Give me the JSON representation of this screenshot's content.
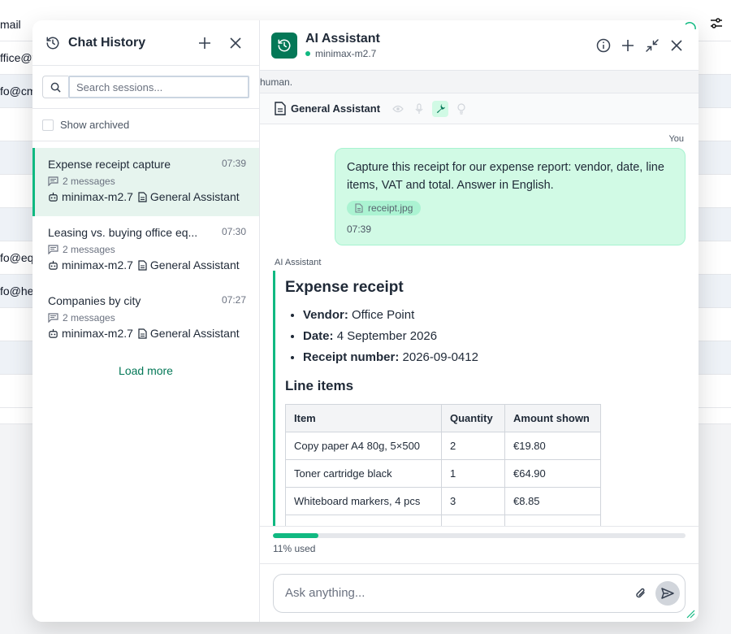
{
  "background": {
    "header_col": "mail",
    "cells": [
      "ffice@y",
      "fo@cm",
      "",
      "",
      "",
      "",
      "fo@eq",
      "fo@he",
      "",
      "",
      ""
    ]
  },
  "history": {
    "title": "Chat History",
    "search_placeholder": "Search sessions...",
    "show_archived_label": "Show archived",
    "sessions": [
      {
        "title": "Expense receipt capture",
        "time": "07:39",
        "messages": "2 messages",
        "model": "minimax-m2.7",
        "assistant": "General Assistant"
      },
      {
        "title": "Leasing vs. buying office eq...",
        "time": "07:30",
        "messages": "2 messages",
        "model": "minimax-m2.7",
        "assistant": "General Assistant"
      },
      {
        "title": "Companies by city",
        "time": "07:27",
        "messages": "2 messages",
        "model": "minimax-m2.7",
        "assistant": "General Assistant"
      }
    ],
    "load_more": "Load more"
  },
  "chat": {
    "title": "AI Assistant",
    "model": "minimax-m2.7",
    "notice": "human.",
    "assistant_name": "General Assistant",
    "you_label": "You",
    "user_message": "Capture this receipt for our expense report: vendor, date, line items, VAT and total. Answer in English.",
    "attachment": "receipt.jpg",
    "user_time": "07:39",
    "ai_label": "AI Assistant",
    "response": {
      "heading": "Expense receipt",
      "facts": [
        {
          "key": "Vendor:",
          "value": "Office Point"
        },
        {
          "key": "Date:",
          "value": "4 September 2026"
        },
        {
          "key": "Receipt number:",
          "value": "2026-09-0412"
        }
      ],
      "subheading": "Line items",
      "table_headers": [
        "Item",
        "Quantity",
        "Amount shown"
      ],
      "table_rows": [
        [
          "Copy paper A4 80g, 5×500",
          "2",
          "€19.80"
        ],
        [
          "Toner cartridge black",
          "1",
          "€64.90"
        ],
        [
          "Whiteboard markers, 4 pcs",
          "3",
          "€8.85"
        ]
      ]
    },
    "usage_text": "11% used",
    "usage_fraction": 0.11,
    "composer_placeholder": "Ask anything..."
  }
}
